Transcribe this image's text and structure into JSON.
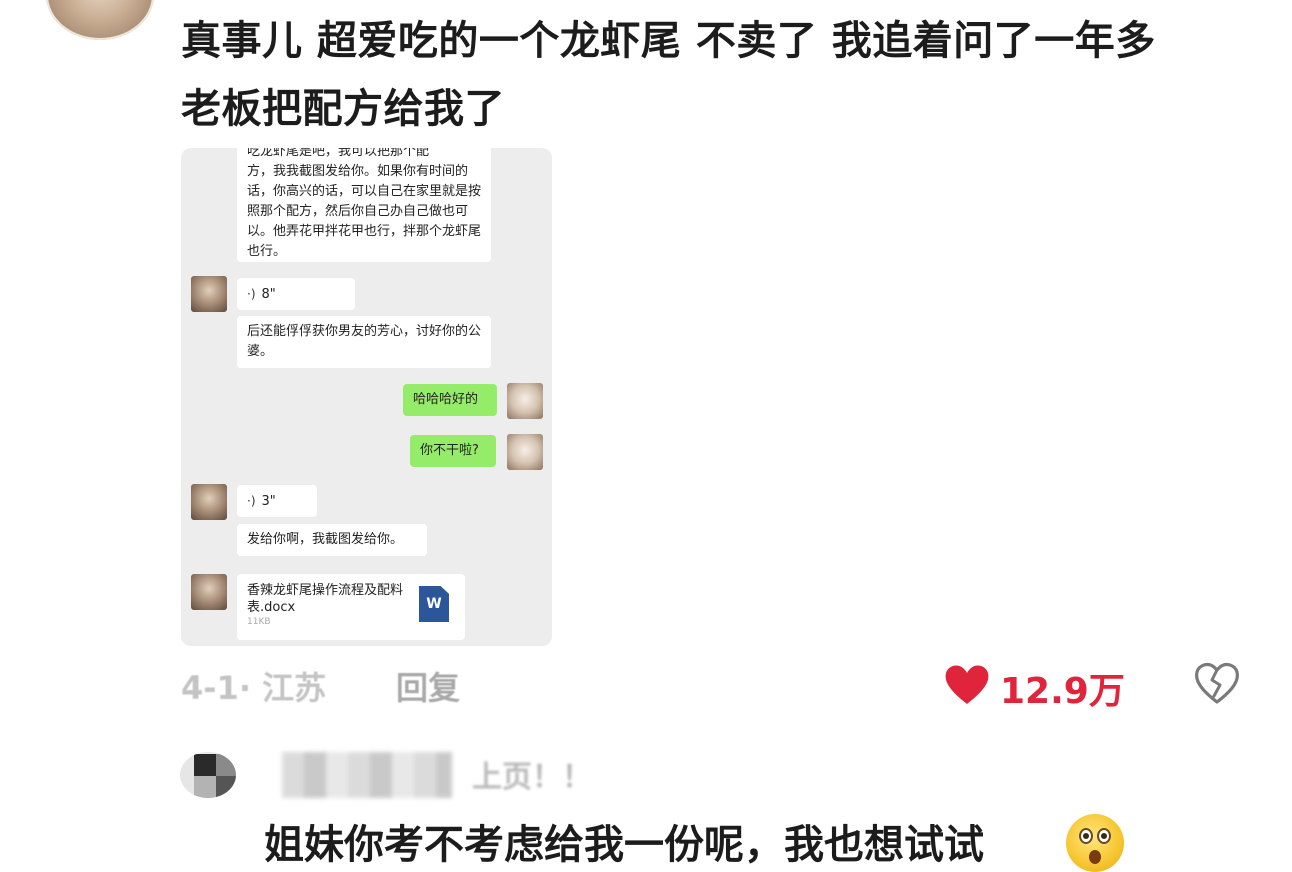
{
  "post": {
    "title_line1": "真事儿 超爱吃的一个龙虾尾 不卖了 我追着问了一年多",
    "title_line2": "老板把配方给我了"
  },
  "chat": {
    "top_cut_text": "吃龙虾尾是吧，我可以把那个配",
    "message1": "方，我我截图发给你。如果你有时间的话，你高兴的话，可以自己在家里就是按照那个配方，然后你自己办自己做也可以。他弄花甲拌花甲也行，拌那个龙虾尾也行。",
    "voice1_duration": "8\"",
    "message2": "后还能俘俘获你男友的芳心，讨好你的公婆。",
    "reply1": "哈哈哈好的",
    "reply2": "你不干啦?",
    "voice2_duration": "3\"",
    "message3": "发给你啊，我截图发给你。",
    "file_name": "香辣龙虾尾操作流程及配料表.docx",
    "file_size": "11KB",
    "file_badge": "W"
  },
  "meta": {
    "date_location": "4-1· 江苏",
    "reply_label": "回复",
    "like_count": "12.9万"
  },
  "comment": {
    "tail_text": "上页！！",
    "text": "姐妹你考不考虑给我一份呢，我也想试试"
  },
  "icons": {
    "like": "heart-icon",
    "dislike": "broken-heart-icon",
    "emoji": "surprised-face-emoji",
    "file": "word-doc-icon",
    "voice": "voice-wave-icon"
  },
  "colors": {
    "like_red": "#e0243b",
    "wechat_green": "#95ec69",
    "chat_bg": "#ededed",
    "muted_gray": "#c4c4c4"
  }
}
